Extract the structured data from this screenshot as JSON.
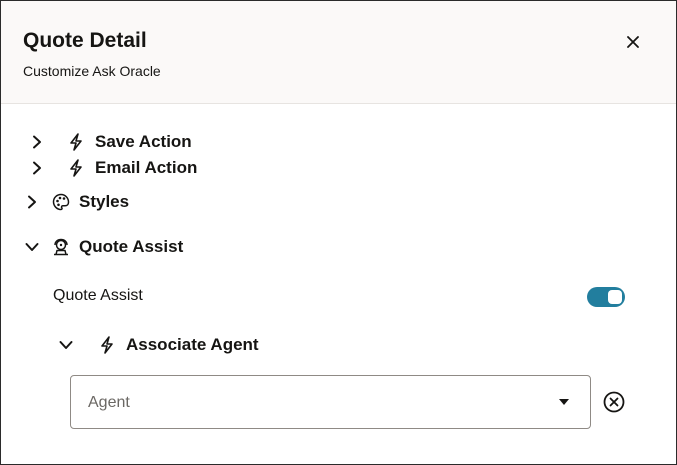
{
  "header": {
    "title": "Quote Detail",
    "subtitle": "Customize Ask Oracle"
  },
  "sections": [
    {
      "label": "Save Action",
      "icon": "lightning-icon",
      "expanded": false
    },
    {
      "label": "Email Action",
      "icon": "lightning-icon",
      "expanded": false
    },
    {
      "label": "Styles",
      "icon": "palette-icon",
      "expanded": false
    },
    {
      "label": "Quote Assist",
      "icon": "agent-icon",
      "expanded": true
    }
  ],
  "quote_assist": {
    "toggle_label": "Quote Assist",
    "toggle_on": true,
    "associate_agent": {
      "label": "Associate Agent",
      "icon": "lightning-icon",
      "expanded": true,
      "select_placeholder": "Agent"
    }
  },
  "colors": {
    "accent": "#227e9e",
    "header_bg": "#fbf9f8",
    "text": "#161513"
  }
}
